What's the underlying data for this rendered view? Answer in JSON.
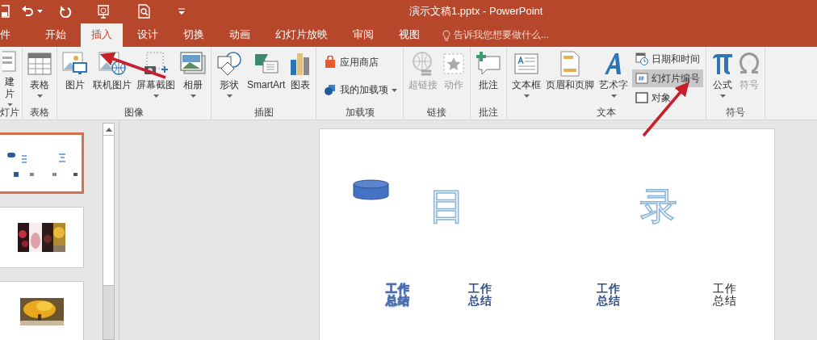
{
  "window": {
    "title": "演示文稿1.pptx - PowerPoint"
  },
  "tabs": [
    {
      "label": "件",
      "selected": false
    },
    {
      "label": "开始",
      "selected": false
    },
    {
      "label": "插入",
      "selected": true
    },
    {
      "label": "设计",
      "selected": false
    },
    {
      "label": "切换",
      "selected": false
    },
    {
      "label": "动画",
      "selected": false
    },
    {
      "label": "幻灯片放映",
      "selected": false
    },
    {
      "label": "审阅",
      "selected": false
    },
    {
      "label": "视图",
      "selected": false
    }
  ],
  "tell_me": {
    "placeholder": "告诉我您想要做什么..."
  },
  "ribbon": [
    {
      "label": "灯片",
      "items": [
        {
          "kind": "big",
          "label": "建片",
          "dropdown": true,
          "disabled": false
        }
      ]
    },
    {
      "label": "表格",
      "items": [
        {
          "kind": "big",
          "label": "表格",
          "dropdown": true,
          "disabled": false
        }
      ]
    },
    {
      "label": "图像",
      "items": [
        {
          "kind": "big",
          "label": "图片",
          "dropdown": false,
          "disabled": false
        },
        {
          "kind": "big",
          "label": "联机图片",
          "dropdown": false,
          "disabled": false
        },
        {
          "kind": "big",
          "label": "屏幕截图",
          "dropdown": true,
          "disabled": false
        },
        {
          "kind": "big",
          "label": "相册",
          "dropdown": true,
          "disabled": false
        }
      ]
    },
    {
      "label": "插图",
      "items": [
        {
          "kind": "big",
          "label": "形状",
          "dropdown": true,
          "disabled": false
        },
        {
          "kind": "big",
          "label": "SmartArt",
          "dropdown": false,
          "disabled": false
        },
        {
          "kind": "big",
          "label": "图表",
          "dropdown": false,
          "disabled": false
        }
      ]
    },
    {
      "label": "加载项",
      "items": [
        {
          "kind": "small",
          "label": "应用商店",
          "dropdown": false,
          "disabled": false,
          "selected": false
        },
        {
          "kind": "small",
          "label": "我的加载项",
          "dropdown": true,
          "disabled": false,
          "selected": false
        }
      ]
    },
    {
      "label": "链接",
      "items": [
        {
          "kind": "big",
          "label": "超链接",
          "dropdown": false,
          "disabled": true
        },
        {
          "kind": "big",
          "label": "动作",
          "dropdown": false,
          "disabled": true
        }
      ]
    },
    {
      "label": "批注",
      "items": [
        {
          "kind": "big",
          "label": "批注",
          "dropdown": false,
          "disabled": false
        }
      ]
    },
    {
      "label": "文本",
      "items": [
        {
          "kind": "big",
          "label": "文本框",
          "dropdown": true,
          "disabled": false
        },
        {
          "kind": "big",
          "label": "页眉和页脚",
          "dropdown": false,
          "disabled": false
        },
        {
          "kind": "big",
          "label": "艺术字",
          "dropdown": true,
          "disabled": false
        },
        {
          "kind": "small",
          "label": "日期和时间",
          "dropdown": false,
          "disabled": false,
          "selected": false
        },
        {
          "kind": "small",
          "label": "幻灯片编号",
          "dropdown": false,
          "disabled": false,
          "selected": true
        },
        {
          "kind": "small",
          "label": "对象",
          "dropdown": false,
          "disabled": false,
          "selected": false
        }
      ]
    },
    {
      "label": "符号",
      "items": [
        {
          "kind": "big",
          "label": "公式",
          "dropdown": true,
          "disabled": false
        },
        {
          "kind": "big",
          "label": "符号",
          "dropdown": false,
          "disabled": true
        }
      ]
    }
  ],
  "slides": [
    {
      "selected": true
    },
    {
      "selected": false
    },
    {
      "selected": false
    }
  ],
  "slide": {
    "title_chars": [
      "目",
      "录"
    ],
    "items": [
      {
        "kind": "outline",
        "text": "工作总结"
      },
      {
        "kind": "bold",
        "text": "工作总结"
      },
      {
        "kind": "bold",
        "text": "工作总结"
      },
      {
        "kind": "plain",
        "text": "工作总结"
      }
    ]
  }
}
